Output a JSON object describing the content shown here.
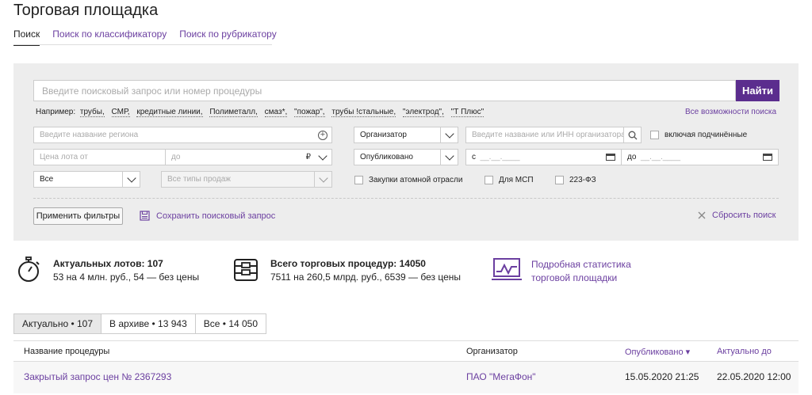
{
  "page": {
    "title": "Торговая площадка"
  },
  "tabs": [
    {
      "label": "Поиск"
    },
    {
      "label": "Поиск по классификатору"
    },
    {
      "label": "Поиск по рубрикатору"
    }
  ],
  "search": {
    "placeholder": "Введите поисковый запрос или номер процедуры",
    "button_label": "Найти"
  },
  "examples": {
    "label": "Например:",
    "items": [
      "трубы,",
      "СМР,",
      "кредитные линии,",
      "Полиметалл,",
      "смаз*,",
      "\"пожар\",",
      "трубы !стальные,",
      "\"электрод\",",
      "\"Т Плюс\""
    ]
  },
  "all_options_link": "Все возможности поиска",
  "filters": {
    "region_placeholder": "Введите название региона",
    "organizer_select": "Организатор",
    "organizer_placeholder": "Введите название или ИНН организатора",
    "include_subsidiaries": "включая подчинённые",
    "price_from": "Цена лота от",
    "price_to": "до",
    "currency": "₽",
    "date_type_select": "Опубликовано",
    "date_from_prefix": "с",
    "date_from_mask": "__.__.____",
    "date_to_prefix": "до",
    "date_to_mask": "__.__.____",
    "status_select": "Все",
    "sale_types_select": "Все типы продаж",
    "atomic": "Закупки атомной отрасли",
    "msp": "Для МСП",
    "fz223": "223-ФЗ",
    "apply_button": "Применить фильтры",
    "save_query": "Сохранить поисковый запрос",
    "reset": "Сбросить поиск"
  },
  "stats": {
    "lots_title": "Актуальных лотов: 107",
    "lots_detail": "53 на 4 млн. руб., 54 — без цены",
    "procedures_title": "Всего торговых процедур: 14050",
    "procedures_detail": "7511 на 260,5 млрд. руб., 6539 — без цены",
    "link_line1": "Подробная статистика",
    "link_line2": "торговой площадки"
  },
  "segments": [
    {
      "label": "Актуально • 107"
    },
    {
      "label": "В архиве • 13 943"
    },
    {
      "label": "Все • 14 050"
    }
  ],
  "table": {
    "columns": [
      "Название процедуры",
      "Организатор",
      "Опубликовано ▾",
      "Актуально до"
    ],
    "rows": [
      {
        "name": "Закрытый запрос цен № 2367293",
        "organizer": "ПАО \"МегаФон\"",
        "published": "15.05.2020 21:25",
        "until": "22.05.2020 12:00"
      }
    ]
  },
  "colors": {
    "accent": "#5b2d8e",
    "link": "#6b3fa0",
    "panel": "#ededed"
  }
}
